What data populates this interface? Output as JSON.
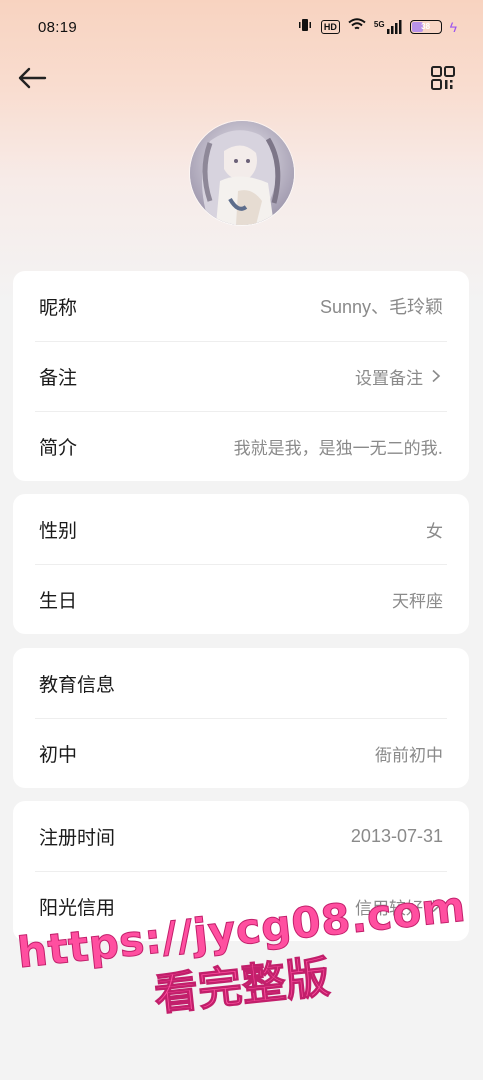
{
  "status_bar": {
    "time": "08:19",
    "network": "5G",
    "hd_label": "HD",
    "battery": "38",
    "battery_level": 0.38,
    "charging": true
  },
  "nav": {
    "back_icon": "back-arrow-icon",
    "qr_icon": "qr-code-icon"
  },
  "profile": {
    "avatar": "avatar-image"
  },
  "cards": {
    "basic": {
      "nickname_label": "昵称",
      "nickname_value": "Sunny、毛玲颖",
      "remark_label": "备注",
      "remark_value": "设置备注",
      "intro_label": "简介",
      "intro_value": "我就是我，是独一无二的我."
    },
    "personal": {
      "gender_label": "性别",
      "gender_value": "女",
      "birthday_label": "生日",
      "birthday_value": "天秤座"
    },
    "education": {
      "title_label": "教育信息",
      "middle_school_label": "初中",
      "middle_school_value": "衙前初中"
    },
    "account": {
      "register_label": "注册时间",
      "register_value": "2013-07-31",
      "credit_label": "阳光信用",
      "credit_value": "信用较好"
    }
  },
  "watermark": {
    "line1": "https://jycg08.com",
    "line2": "看完整版"
  },
  "colors": {
    "accent_pink": "#ff4fa0",
    "battery_purple": "#b892e8",
    "hero_peach": "#f8d3c0"
  }
}
